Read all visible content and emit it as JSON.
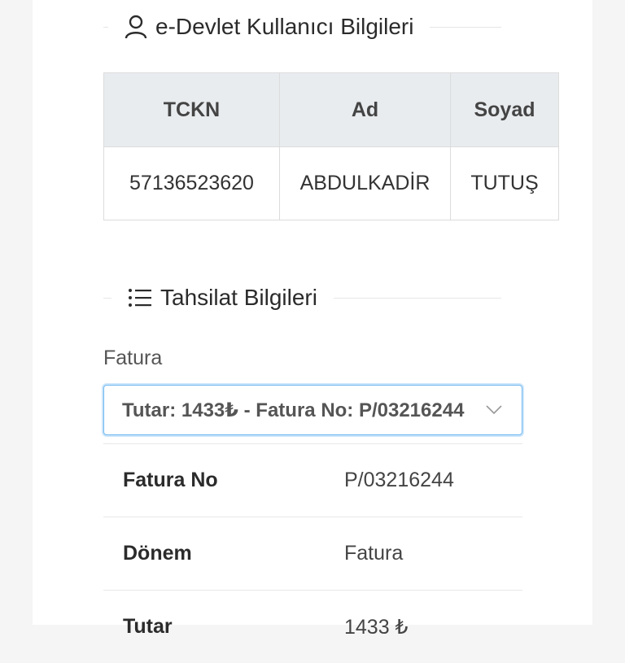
{
  "user_section": {
    "title": "e-Devlet Kullanıcı Bilgileri",
    "icon": "user-icon",
    "table": {
      "headers": [
        "TCKN",
        "Ad",
        "Soyad"
      ],
      "row": [
        "57136523620",
        "ABDULKADİR",
        "TUTUŞ"
      ]
    }
  },
  "payment_section": {
    "title": "Tahsilat Bilgileri",
    "icon": "list-icon",
    "invoice_label": "Fatura",
    "invoice_select_value": "Tutar: 1433₺ - Fatura No: P/03216244",
    "details": [
      {
        "key": "Fatura No",
        "value": "P/03216244"
      },
      {
        "key": "Dönem",
        "value": "Fatura"
      },
      {
        "key": "Tutar",
        "value": "1433 ₺"
      }
    ]
  },
  "colors": {
    "header_bg": "#e9ecef",
    "focus_border": "#6fb7f0"
  }
}
